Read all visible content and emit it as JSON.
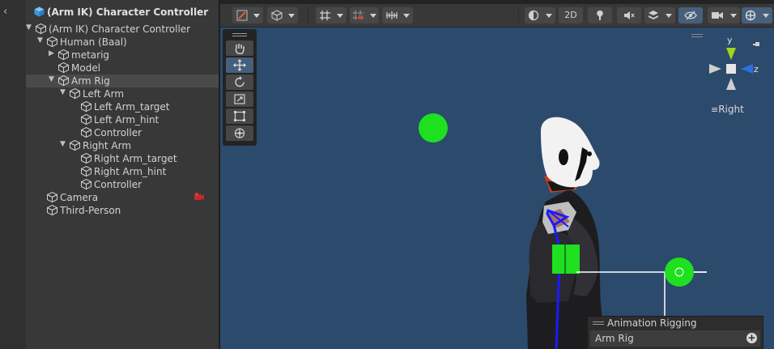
{
  "hierarchy": {
    "back_icon": "chevron-left-icon",
    "scene_title": "(Arm IK) Character Controller",
    "items": [
      {
        "label": "(Arm IK) Character Controller",
        "depth": 1,
        "arrow": "expanded"
      },
      {
        "label": "Human (Baal)",
        "depth": 2,
        "arrow": "expanded"
      },
      {
        "label": "metarig",
        "depth": 3,
        "arrow": "collapsed"
      },
      {
        "label": "Model",
        "depth": 3,
        "arrow": "none"
      },
      {
        "label": "Arm Rig",
        "depth": 3,
        "arrow": "expanded",
        "selected": true
      },
      {
        "label": "Left Arm",
        "depth": 4,
        "arrow": "expanded"
      },
      {
        "label": "Left Arm_target",
        "depth": 5,
        "arrow": "none"
      },
      {
        "label": "Left Arm_hint",
        "depth": 5,
        "arrow": "none"
      },
      {
        "label": "Controller",
        "depth": 5,
        "arrow": "none"
      },
      {
        "label": "Right Arm",
        "depth": 4,
        "arrow": "expanded"
      },
      {
        "label": "Right Arm_target",
        "depth": 5,
        "arrow": "none"
      },
      {
        "label": "Right Arm_hint",
        "depth": 5,
        "arrow": "none"
      },
      {
        "label": "Controller",
        "depth": 5,
        "arrow": "none"
      },
      {
        "label": "Camera",
        "depth": 2,
        "arrow": "none",
        "badge": "camera-icon"
      },
      {
        "label": "Third-Person",
        "depth": 2,
        "arrow": "none"
      }
    ]
  },
  "toolbar": {
    "left": [
      "transform-tool-icon",
      "cube-icon",
      "grid-snap-icon",
      "increment-snap-icon",
      "ruler-icon"
    ],
    "mode_2d": "2D",
    "right": [
      "shading-mode-icon",
      "lighting-icon",
      "audio-icon",
      "effects-icon",
      "visibility-icon",
      "camera-settings-icon",
      "gizmos-icon"
    ]
  },
  "tools": [
    "hand-icon",
    "move-icon",
    "rotate-icon",
    "scale-icon",
    "rect-icon",
    "transform-icon"
  ],
  "gizmo": {
    "y_label": "y",
    "z_label": "z",
    "view": "Right"
  },
  "overlay": {
    "title": "Animation Rigging",
    "value": "Arm Rig"
  },
  "colors": {
    "selection": "#4a4a4a",
    "scene_bg": "#2c4a6c",
    "handle_green": "#1fe01f",
    "bone_blue": "#1a1aff",
    "active_tool": "#46607c"
  }
}
